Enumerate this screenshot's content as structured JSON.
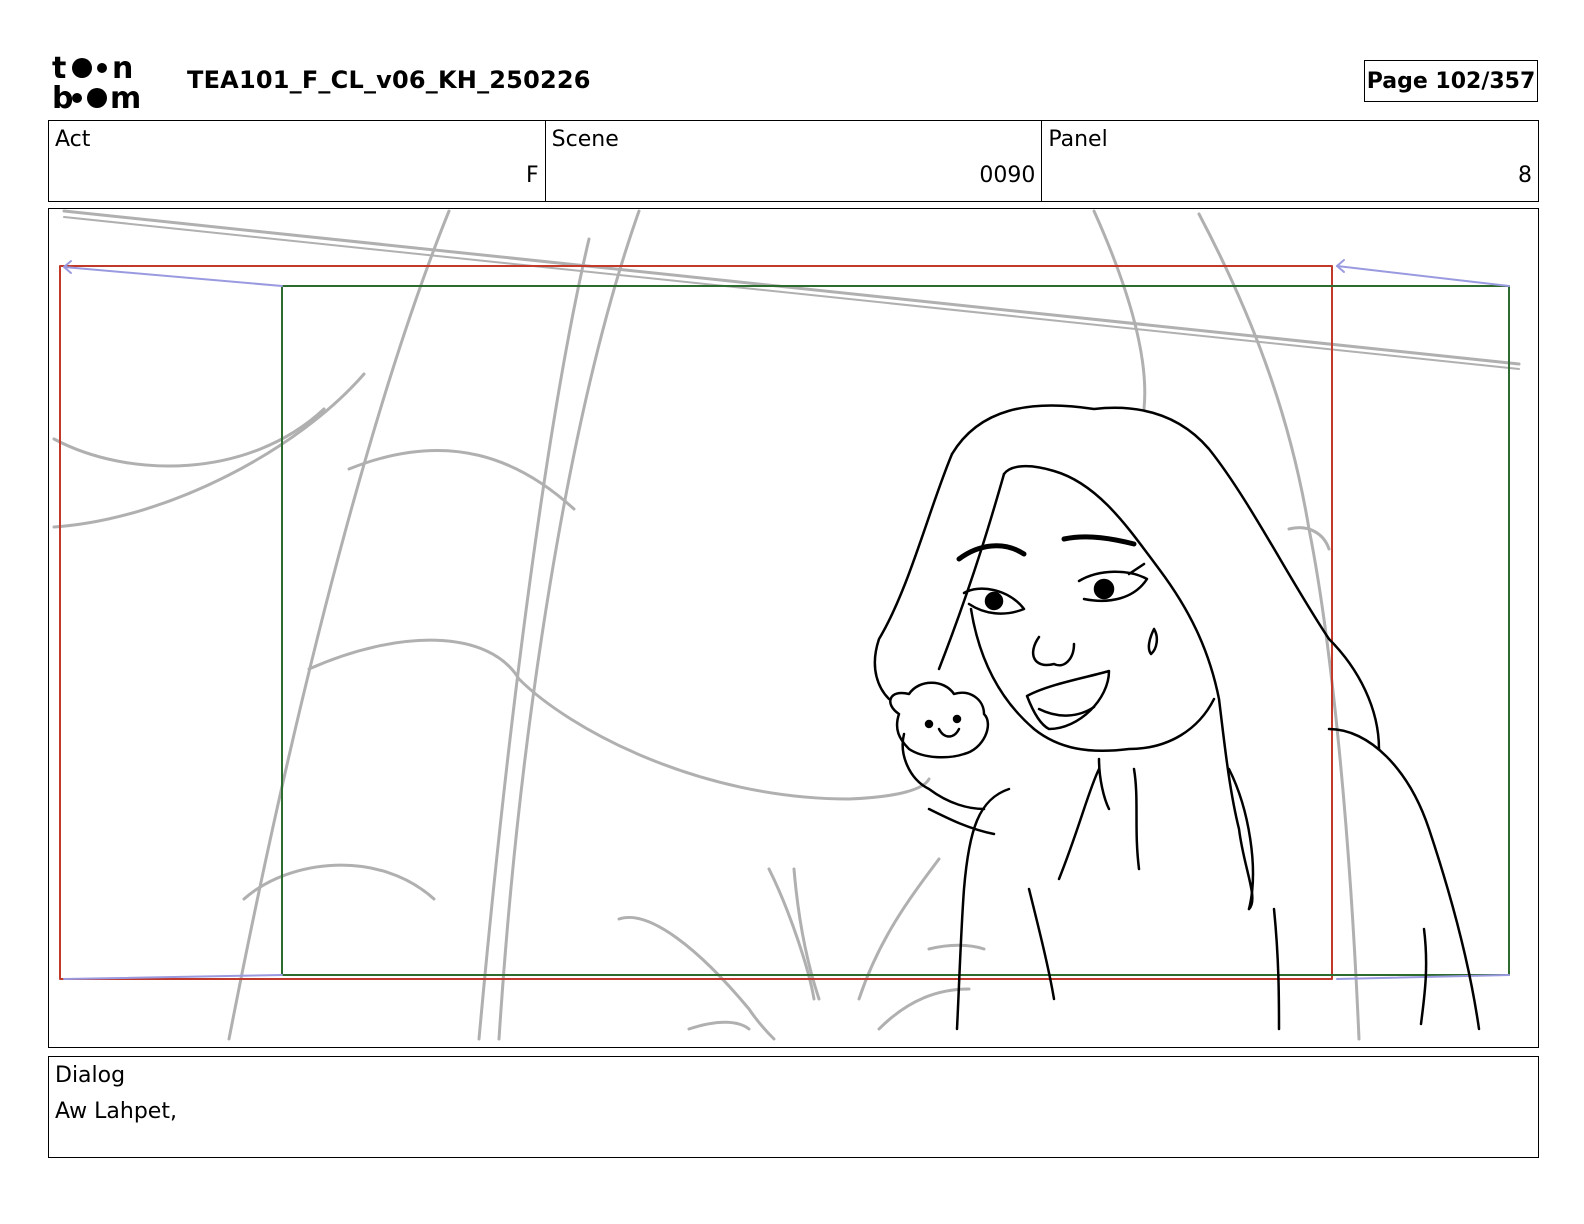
{
  "header": {
    "logo_text": "toon boom",
    "title": "TEA101_F_CL_v06_KH_250226",
    "page": "Page 102/357"
  },
  "info": {
    "act_label": "Act",
    "act_value": "F",
    "scene_label": "Scene",
    "scene_value": "0090",
    "panel_label": "Panel",
    "panel_value": "8"
  },
  "dialog": {
    "label": "Dialog",
    "text": "Aw Lahpet,"
  },
  "colors": {
    "safe_frame": "#c0392b",
    "camera_frame": "#2e6b2e",
    "rough_lines": "#b0b0b0",
    "ink_lines": "#000000",
    "motion_arrows": "#9a9ae0"
  }
}
